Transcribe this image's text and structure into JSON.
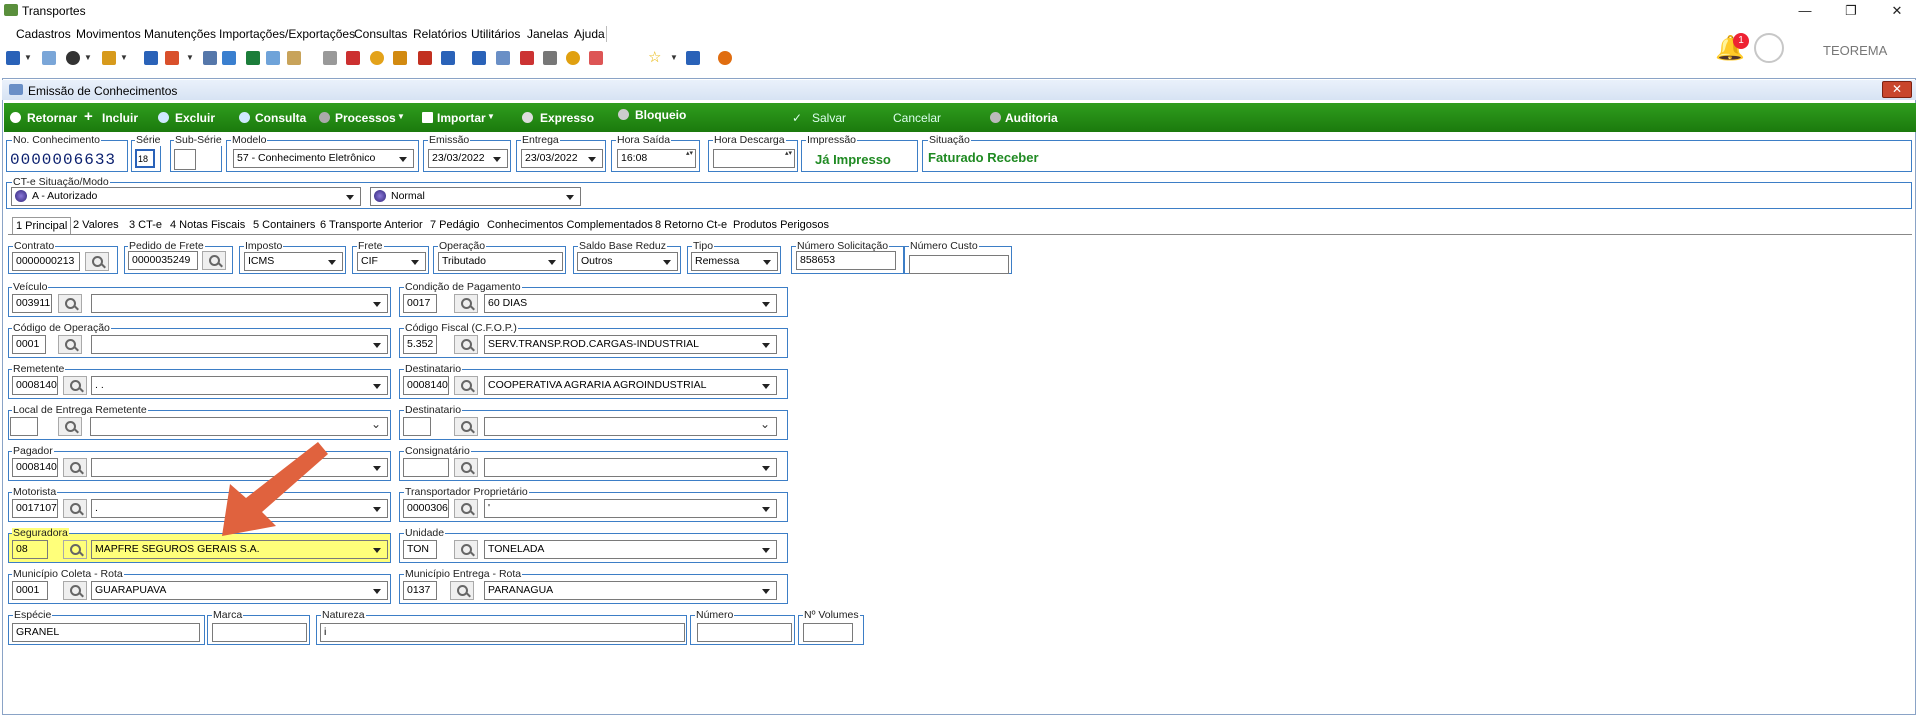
{
  "app": {
    "title": "Transportes",
    "user": "TEOREMA",
    "notifications": "1"
  },
  "window_controls": {
    "minimize": "—",
    "maximize": "❐",
    "close": "✕"
  },
  "menu": [
    "Cadastros",
    "Movimentos",
    "Manutenções",
    "Importações/Exportações",
    "Consultas",
    "Relatórios",
    "Utilitários",
    "Janelas",
    "Ajuda"
  ],
  "window": {
    "title": "Emissão de Conhecimentos",
    "close": "✕"
  },
  "actions": {
    "retornar": "Retornar",
    "incluir": "Incluir",
    "excluir": "Excluir",
    "consulta": "Consulta",
    "processos": "Processos",
    "importar": "Importar",
    "expresso": "Expresso",
    "bloqueio": "Bloqueio",
    "salvar": "Salvar",
    "cancelar": "Cancelar",
    "auditoria": "Auditoria"
  },
  "header": {
    "no_conhecimento": {
      "label": "No. Conhecimento",
      "value": "0000006633"
    },
    "serie": {
      "label": "Série",
      "value": "18"
    },
    "sub_serie": {
      "label": "Sub-Série",
      "value": ""
    },
    "modelo": {
      "label": "Modelo",
      "value": "57 - Conhecimento Eletrônico"
    },
    "emissao": {
      "label": "Emissão",
      "value": "23/03/2022"
    },
    "entrega": {
      "label": "Entrega",
      "value": "23/03/2022"
    },
    "hora_saida": {
      "label": "Hora Saída",
      "value": "16:08"
    },
    "hora_descarga": {
      "label": "Hora Descarga",
      "value": ""
    },
    "impressao": {
      "label": "Impressão",
      "value": "Já Impresso"
    },
    "situacao": {
      "label": "Situação",
      "value": "Faturado Receber"
    }
  },
  "cte": {
    "label": "CT-e Situação/Modo",
    "situacao": "A - Autorizado",
    "modo": "Normal"
  },
  "tabs": [
    "1 Principal",
    "2 Valores",
    "3 CT-e",
    "4 Notas Fiscais",
    "5 Containers",
    "6 Transporte Anterior",
    "7 Pedágio",
    "Conhecimentos Complementados",
    "8 Retorno Ct-e",
    "Produtos Perigosos"
  ],
  "row1": {
    "contrato": {
      "label": "Contrato",
      "value": "0000000213"
    },
    "pedido": {
      "label": "Pedido de Frete",
      "value": "0000035249"
    },
    "imposto": {
      "label": "Imposto",
      "value": "ICMS"
    },
    "frete": {
      "label": "Frete",
      "value": "CIF"
    },
    "operacao": {
      "label": "Operação",
      "value": "Tributado"
    },
    "saldo": {
      "label": "Saldo Base Reduz",
      "value": "Outros"
    },
    "tipo": {
      "label": "Tipo",
      "value": "Remessa"
    },
    "num_solic": {
      "label": "Número Solicitação",
      "value": "858653"
    },
    "num_custo": {
      "label": "Número Custo",
      "value": ""
    }
  },
  "left": [
    {
      "label": "Veículo",
      "code": "003911",
      "desc": ""
    },
    {
      "label": "Código de Operação",
      "code": "0001",
      "desc": ""
    },
    {
      "label": "Remetente",
      "code": "0008140",
      "desc": ". ."
    },
    {
      "label": "Local de Entrega Remetente",
      "code": "",
      "desc": ""
    },
    {
      "label": "Pagador",
      "code": "0008140",
      "desc": ""
    },
    {
      "label": "Motorista",
      "code": "0017107",
      "desc": "."
    },
    {
      "label": "Seguradora",
      "code": "08",
      "desc": "MAPFRE SEGUROS GERAIS S.A."
    },
    {
      "label": "Município Coleta - Rota",
      "code": "0001",
      "desc": "GUARAPUAVA"
    }
  ],
  "right": [
    {
      "label": "Condição de Pagamento",
      "code": "0017",
      "desc": "60 DIAS"
    },
    {
      "label": "Código Fiscal (C.F.O.P.)",
      "code": "5.352",
      "desc": "SERV.TRANSP.ROD.CARGAS-INDUSTRIAL"
    },
    {
      "label": "Destinatario",
      "code": "0008140",
      "desc": "COOPERATIVA AGRARIA AGROINDUSTRIAL"
    },
    {
      "label": "Destinatario",
      "code": "",
      "desc": ""
    },
    {
      "label": "Consignatário",
      "code": "",
      "desc": ""
    },
    {
      "label": "Transportador Proprietário",
      "code": "0000306",
      "desc": "'"
    },
    {
      "label": "Unidade",
      "code": "TON",
      "desc": "TONELADA"
    },
    {
      "label": "Município Entrega - Rota",
      "code": "0137",
      "desc": "PARANAGUA"
    }
  ],
  "bottom": {
    "especie": {
      "label": "Espécie",
      "value": "GRANEL"
    },
    "marca": {
      "label": "Marca",
      "value": ""
    },
    "natureza": {
      "label": "Natureza",
      "value": "i"
    },
    "numero": {
      "label": "Número",
      "value": ""
    },
    "volumes": {
      "label": "Nº Volumes",
      "value": ""
    }
  },
  "colors": {
    "action_bar": "#1b7a0d",
    "highlight": "#ffff7a",
    "arrow": "#e0623e",
    "group_border": "#3d7ec6"
  }
}
